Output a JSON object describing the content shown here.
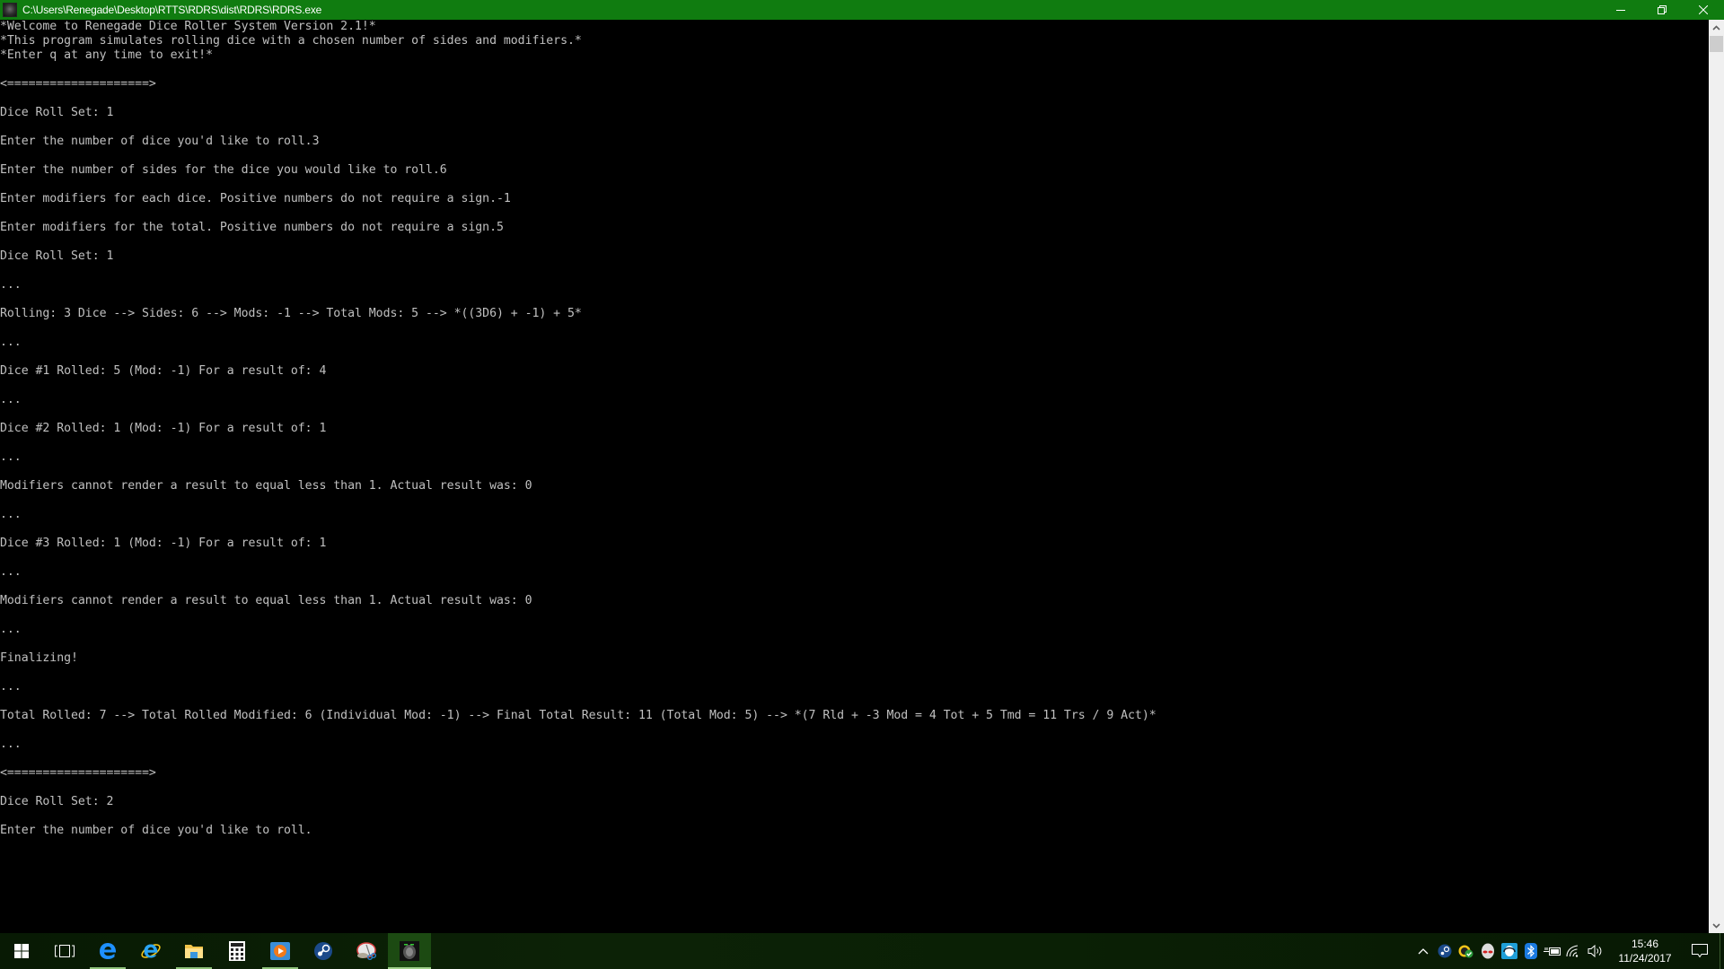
{
  "window": {
    "title": "C:\\Users\\Renegade\\Desktop\\RTTS\\RDRS\\dist\\RDRS\\RDRS.exe",
    "icon": "rdrs-app-icon",
    "controls": [
      "minimize-icon",
      "restore-icon",
      "close-icon"
    ],
    "accent_color": "#107c10"
  },
  "console": {
    "text_color": "#c0c0c0",
    "background": "#000000",
    "lines": [
      "*Welcome to Renegade Dice Roller System Version 2.1!*",
      "*This program simulates rolling dice with a chosen number of sides and modifiers.*",
      "*Enter q at any time to exit!*",
      "",
      "<====================>",
      "",
      "Dice Roll Set: 1",
      "",
      "Enter the number of dice you'd like to roll.3",
      "",
      "Enter the number of sides for the dice you would like to roll.6",
      "",
      "Enter modifiers for each dice. Positive numbers do not require a sign.-1",
      "",
      "Enter modifiers for the total. Positive numbers do not require a sign.5",
      "",
      "Dice Roll Set: 1",
      "",
      "...",
      "",
      "Rolling: 3 Dice --> Sides: 6 --> Mods: -1 --> Total Mods: 5 --> *((3D6) + -1) + 5*",
      "",
      "...",
      "",
      "Dice #1 Rolled: 5 (Mod: -1) For a result of: 4",
      "",
      "...",
      "",
      "Dice #2 Rolled: 1 (Mod: -1) For a result of: 1",
      "",
      "...",
      "",
      "Modifiers cannot render a result to equal less than 1. Actual result was: 0",
      "",
      "...",
      "",
      "Dice #3 Rolled: 1 (Mod: -1) For a result of: 1",
      "",
      "...",
      "",
      "Modifiers cannot render a result to equal less than 1. Actual result was: 0",
      "",
      "...",
      "",
      "Finalizing!",
      "",
      "...",
      "",
      "Total Rolled: 7 --> Total Rolled Modified: 6 (Individual Mod: -1) --> Final Total Result: 11 (Total Mod: 5) --> *(7 Rld + -3 Mod = 4 Tot + 5 Tmd = 11 Trs / 9 Act)*",
      "",
      "...",
      "",
      "<====================>",
      "",
      "Dice Roll Set: 2",
      "",
      "Enter the number of dice you'd like to roll."
    ]
  },
  "taskbar": {
    "items": [
      {
        "name": "start-button",
        "icon": "windows-logo-icon",
        "running": false,
        "active": false
      },
      {
        "name": "task-view-button",
        "icon": "task-view-icon",
        "running": false,
        "active": false
      },
      {
        "name": "taskbar-edge",
        "icon": "edge-icon",
        "running": true,
        "active": false
      },
      {
        "name": "taskbar-internet-explorer",
        "icon": "internet-explorer-icon",
        "running": false,
        "active": false
      },
      {
        "name": "taskbar-file-explorer",
        "icon": "folder-icon",
        "running": true,
        "active": false
      },
      {
        "name": "taskbar-calculator",
        "icon": "calculator-icon",
        "running": false,
        "active": false
      },
      {
        "name": "taskbar-media-player",
        "icon": "media-player-icon",
        "running": true,
        "active": false
      },
      {
        "name": "taskbar-steam",
        "icon": "steam-icon",
        "running": false,
        "active": false
      },
      {
        "name": "taskbar-snipping-tool",
        "icon": "snipping-tool-icon",
        "running": false,
        "active": false
      },
      {
        "name": "taskbar-rdrs",
        "icon": "rdrs-app-icon",
        "running": true,
        "active": true
      }
    ],
    "tray": {
      "icons": [
        "show-hidden-icons-chevron-icon",
        "steam-tray-icon",
        "norton-tray-icon",
        "alienware-tray-icon",
        "alienware-headset-tray-icon",
        "bluetooth-icon",
        "battery-icon",
        "wifi-icon",
        "volume-icon"
      ],
      "time": "15:46",
      "date": "11/24/2017",
      "action_center": "action-center-icon"
    }
  }
}
